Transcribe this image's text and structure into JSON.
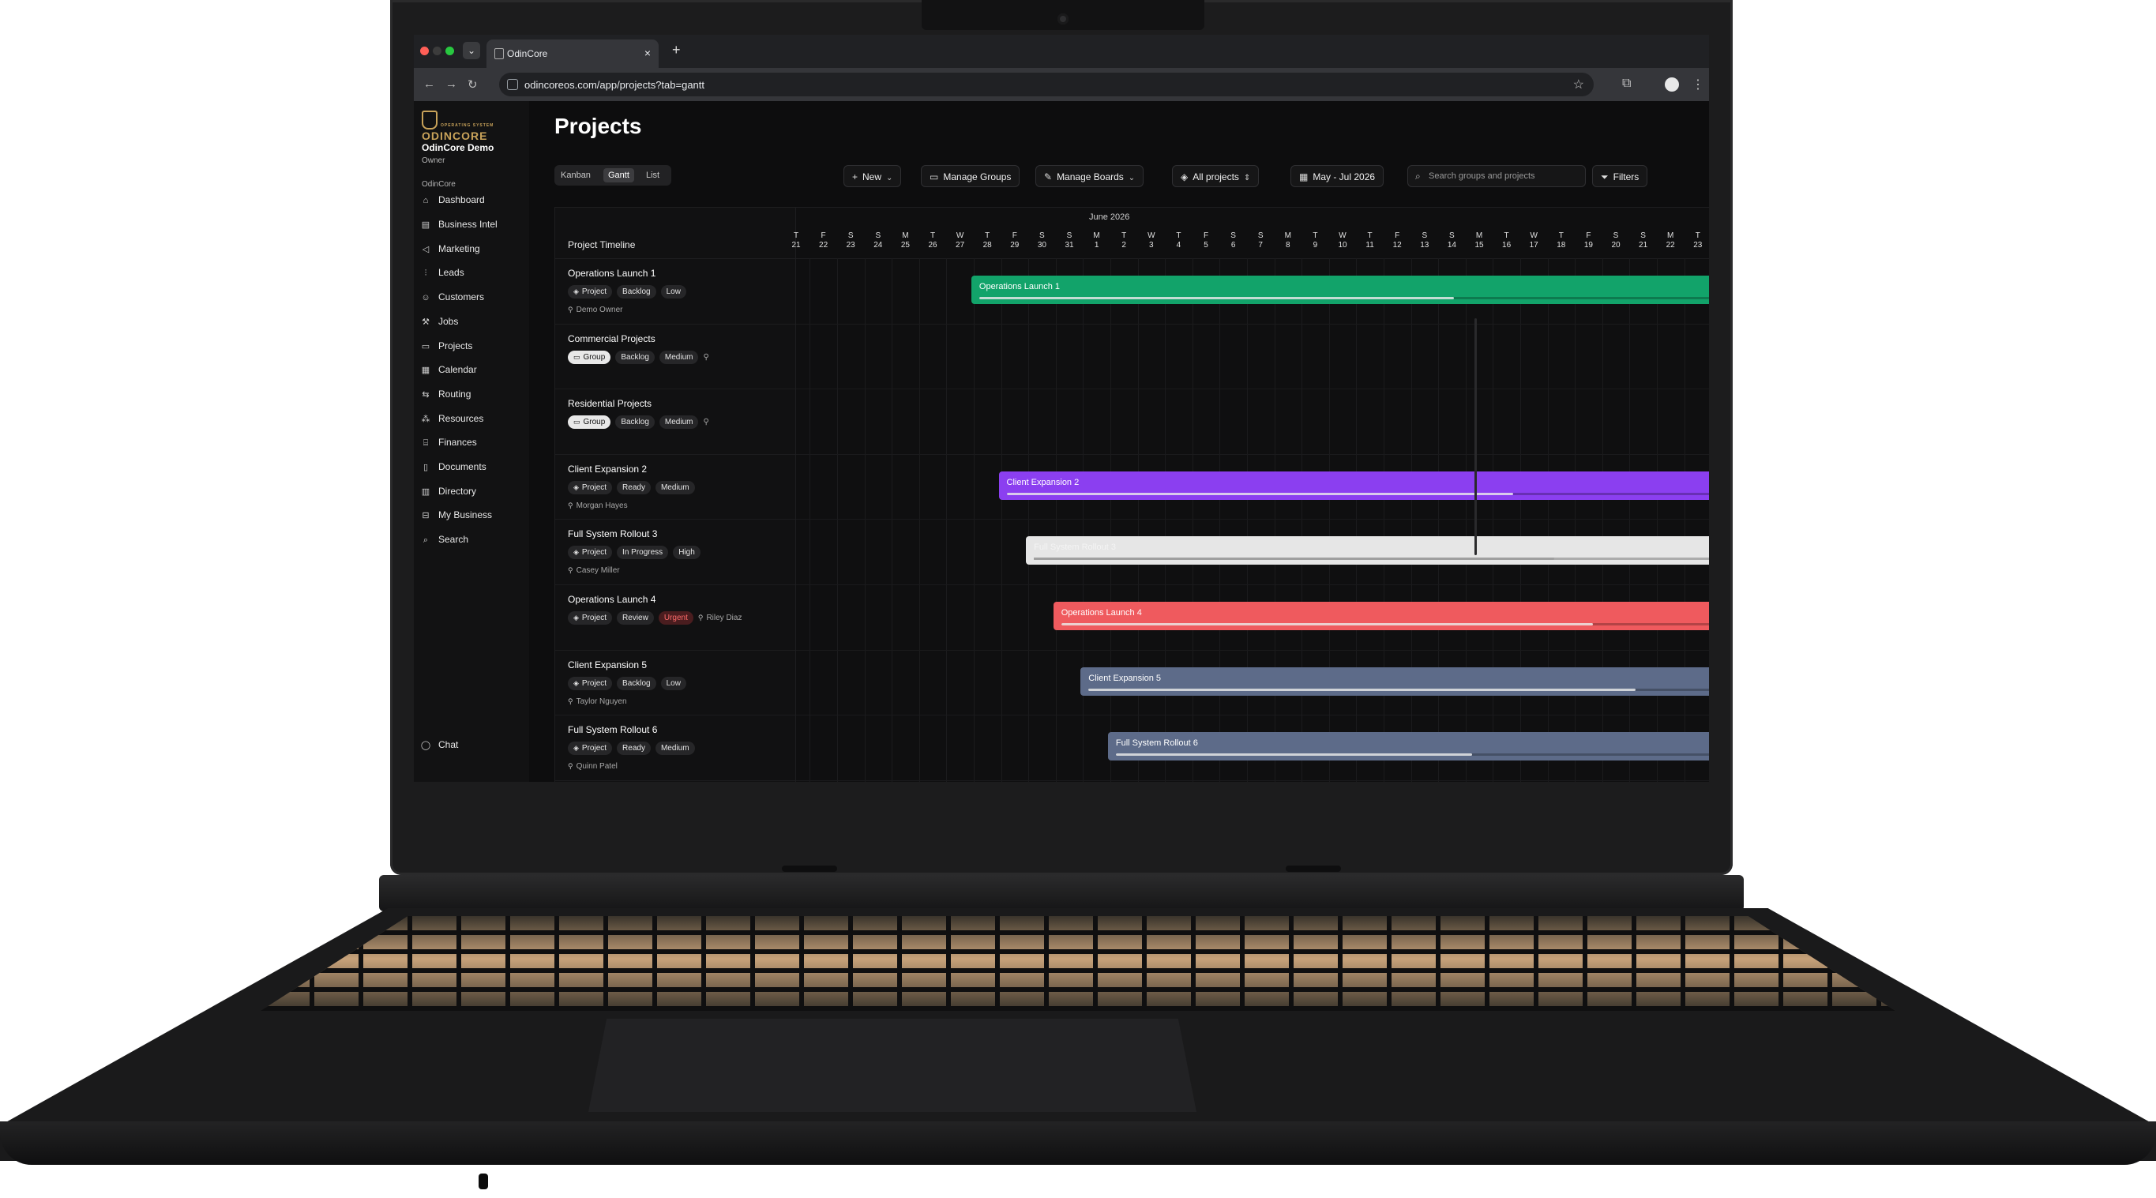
{
  "browser": {
    "tab_title": "OdinCore",
    "url": "odincoreos.com/app/projects?tab=gantt"
  },
  "sidebar": {
    "logo_text": "ODINCORE",
    "logo_subtext": "OPERATING SYSTEM",
    "workspace_name": "OdinCore Demo",
    "workspace_role": "Owner",
    "section_label": "OdinCore",
    "items": [
      {
        "label": "Dashboard",
        "icon": "home-icon"
      },
      {
        "label": "Business Intel",
        "icon": "chart-icon"
      },
      {
        "label": "Marketing",
        "icon": "megaphone-icon"
      },
      {
        "label": "Leads",
        "icon": "funnel-icon"
      },
      {
        "label": "Customers",
        "icon": "users-icon"
      },
      {
        "label": "Jobs",
        "icon": "wrench-icon"
      },
      {
        "label": "Projects",
        "icon": "folder-icon"
      },
      {
        "label": "Calendar",
        "icon": "calendar-icon"
      },
      {
        "label": "Routing",
        "icon": "route-icon"
      },
      {
        "label": "Resources",
        "icon": "boxes-icon"
      },
      {
        "label": "Finances",
        "icon": "bank-icon"
      },
      {
        "label": "Documents",
        "icon": "document-icon"
      },
      {
        "label": "Directory",
        "icon": "book-icon"
      },
      {
        "label": "My Business",
        "icon": "briefcase-icon"
      },
      {
        "label": "Search",
        "icon": "search-icon"
      }
    ],
    "chat_label": "Chat"
  },
  "page": {
    "title": "Projects",
    "views": [
      "Kanban",
      "Gantt",
      "List"
    ],
    "active_view": "Gantt",
    "toolbar": {
      "new_label": "New",
      "manage_groups_label": "Manage Groups",
      "manage_boards_label": "Manage Boards",
      "project_filter_label": "All projects",
      "date_range_label": "May - Jul 2026",
      "search_placeholder": "Search groups and projects",
      "filters_label": "Filters"
    }
  },
  "gantt": {
    "left_header": "Project Timeline",
    "month_label": "June 2026",
    "days": [
      {
        "dow": "T",
        "num": "21"
      },
      {
        "dow": "F",
        "num": "22"
      },
      {
        "dow": "S",
        "num": "23"
      },
      {
        "dow": "S",
        "num": "24"
      },
      {
        "dow": "M",
        "num": "25"
      },
      {
        "dow": "T",
        "num": "26"
      },
      {
        "dow": "W",
        "num": "27"
      },
      {
        "dow": "T",
        "num": "28"
      },
      {
        "dow": "F",
        "num": "29"
      },
      {
        "dow": "S",
        "num": "30"
      },
      {
        "dow": "S",
        "num": "31"
      },
      {
        "dow": "M",
        "num": "1"
      },
      {
        "dow": "T",
        "num": "2"
      },
      {
        "dow": "W",
        "num": "3"
      },
      {
        "dow": "T",
        "num": "4"
      },
      {
        "dow": "F",
        "num": "5"
      },
      {
        "dow": "S",
        "num": "6"
      },
      {
        "dow": "S",
        "num": "7"
      },
      {
        "dow": "M",
        "num": "8"
      },
      {
        "dow": "T",
        "num": "9"
      },
      {
        "dow": "W",
        "num": "10"
      },
      {
        "dow": "T",
        "num": "11"
      },
      {
        "dow": "F",
        "num": "12"
      },
      {
        "dow": "S",
        "num": "13"
      },
      {
        "dow": "S",
        "num": "14"
      },
      {
        "dow": "M",
        "num": "15"
      },
      {
        "dow": "T",
        "num": "16"
      },
      {
        "dow": "W",
        "num": "17"
      },
      {
        "dow": "T",
        "num": "18"
      },
      {
        "dow": "F",
        "num": "19"
      },
      {
        "dow": "S",
        "num": "20"
      },
      {
        "dow": "S",
        "num": "21"
      },
      {
        "dow": "M",
        "num": "22"
      },
      {
        "dow": "T",
        "num": "23"
      }
    ],
    "rows": [
      {
        "name": "Operations Launch 1",
        "kind": "Project",
        "status": "Backlog",
        "priority": "Low",
        "assignee": "Demo Owner",
        "bar": {
          "label": "Operations Launch 1",
          "start_index": 6,
          "color": "#12a36a",
          "progress": 0.65
        }
      },
      {
        "name": "Commercial Projects",
        "kind": "Group",
        "status": "Backlog",
        "priority": "Medium",
        "assignee": "",
        "bar": null
      },
      {
        "name": "Residential Projects",
        "kind": "Group",
        "status": "Backlog",
        "priority": "Medium",
        "assignee": "",
        "bar": null
      },
      {
        "name": "Client Expansion 2",
        "kind": "Project",
        "status": "Ready",
        "priority": "Medium",
        "assignee": "Morgan Hayes",
        "bar": {
          "label": "Client Expansion 2",
          "start_index": 7,
          "color": "#8b3ff0",
          "progress": 0.72
        }
      },
      {
        "name": "Full System Rollout 3",
        "kind": "Project",
        "status": "In Progress",
        "priority": "High",
        "assignee": "Casey Miller",
        "bar": {
          "label": "Full System Rollout 3",
          "start_index": 8,
          "color": "#e6e6e6",
          "progress": 0.77
        }
      },
      {
        "name": "Operations Launch 4",
        "kind": "Project",
        "status": "Review",
        "priority": "Urgent",
        "assignee": "Riley Diaz",
        "bar": {
          "label": "Operations Launch 4",
          "start_index": 9,
          "color": "#ef5a5e",
          "progress": 0.82
        }
      },
      {
        "name": "Client Expansion 5",
        "kind": "Project",
        "status": "Backlog",
        "priority": "Low",
        "assignee": "Taylor Nguyen",
        "bar": {
          "label": "Client Expansion 5",
          "start_index": 10,
          "color": "#5d6b89",
          "progress": 0.88
        }
      },
      {
        "name": "Full System Rollout 6",
        "kind": "Project",
        "status": "Ready",
        "priority": "Medium",
        "assignee": "Quinn Patel",
        "bar": {
          "label": "Full System Rollout 6",
          "start_index": 11,
          "color": "#5d6b89",
          "progress": 0.6
        }
      }
    ]
  }
}
